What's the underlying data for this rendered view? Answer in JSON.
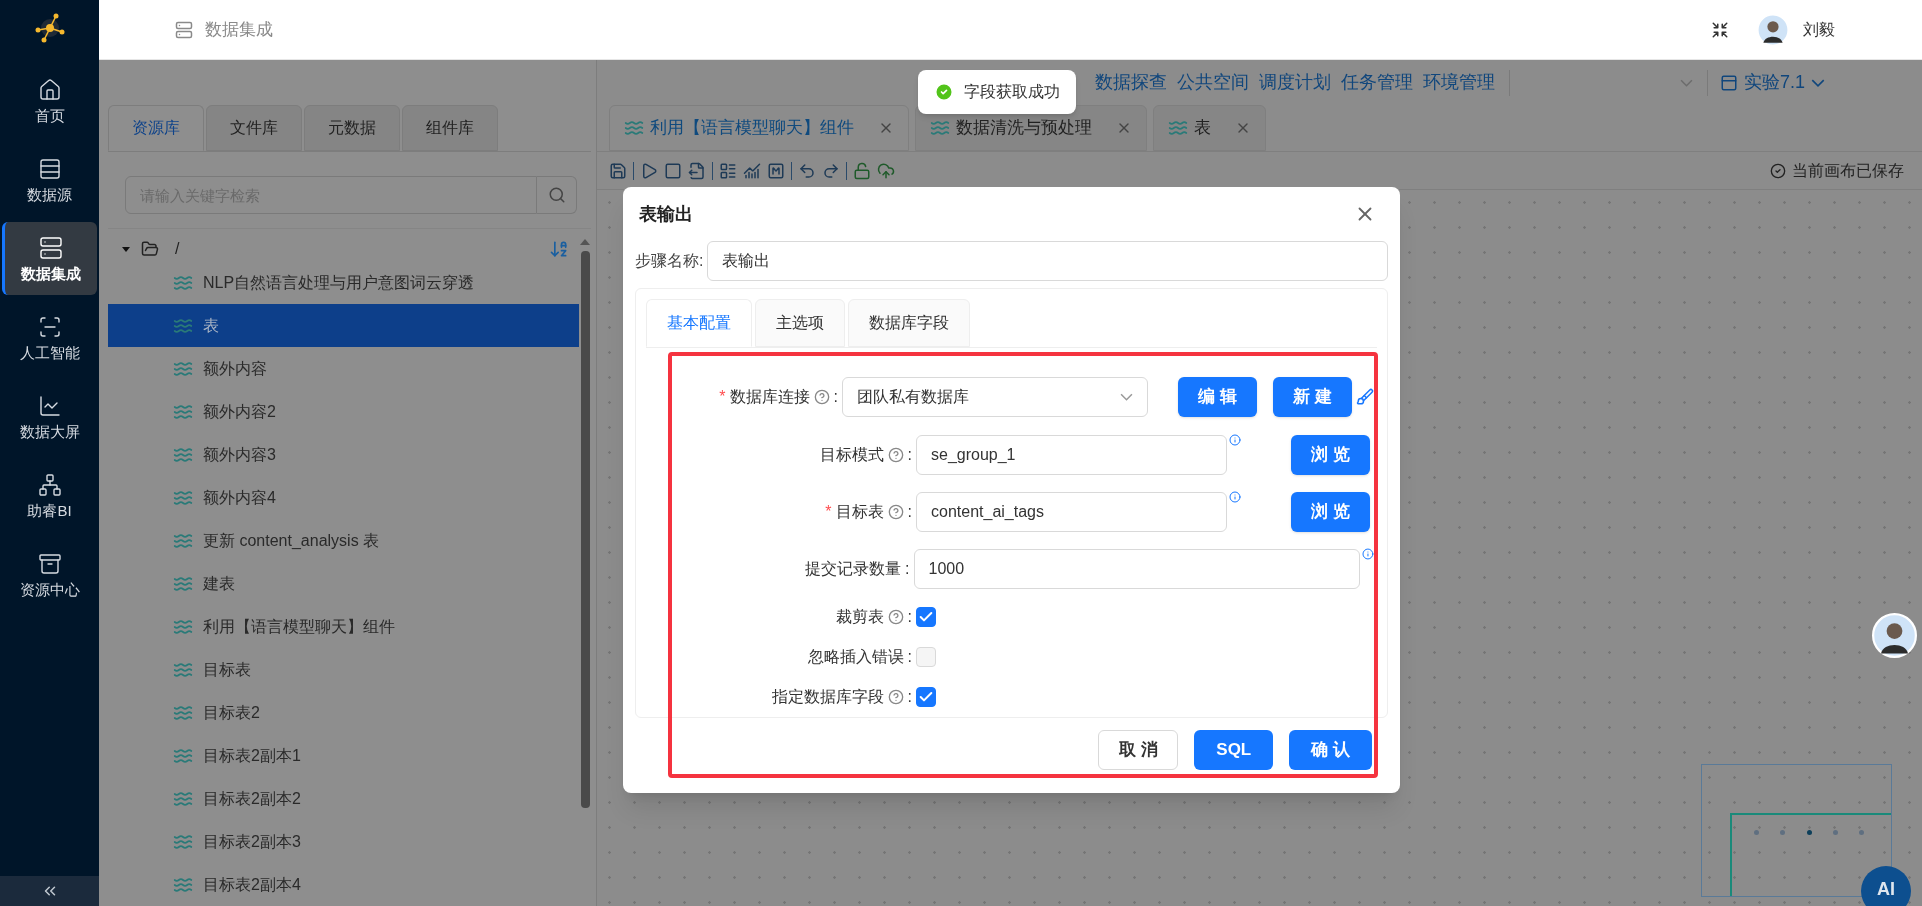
{
  "sidebar": {
    "items": [
      {
        "label": "首页",
        "selected": false
      },
      {
        "label": "数据源",
        "selected": false
      },
      {
        "label": "数据集成",
        "selected": true
      },
      {
        "label": "人工智能",
        "selected": false
      },
      {
        "label": "数据大屏",
        "selected": false
      },
      {
        "label": "助睿BI",
        "selected": false
      },
      {
        "label": "资源中心",
        "selected": false
      }
    ]
  },
  "header": {
    "title": "数据集成",
    "user": "刘毅"
  },
  "top_nav": {
    "links": [
      "数据探查",
      "公共空间",
      "调度计划",
      "任务管理",
      "环境管理"
    ],
    "project": "实验7.1"
  },
  "resource_panel": {
    "tabs": [
      {
        "label": "资源库",
        "selected": true
      },
      {
        "label": "文件库",
        "selected": false
      },
      {
        "label": "元数据",
        "selected": false
      },
      {
        "label": "组件库",
        "selected": false
      }
    ],
    "search": {
      "placeholder": "请输入关键字检索"
    },
    "tree": {
      "label": "/",
      "expanded": true,
      "children": [
        {
          "label": "NLP自然语言处理与用户意图词云穿透",
          "selected": false
        },
        {
          "label": "表",
          "selected": true
        },
        {
          "label": "额外内容",
          "selected": false
        },
        {
          "label": "额外内容2",
          "selected": false
        },
        {
          "label": "额外内容3",
          "selected": false
        },
        {
          "label": "额外内容4",
          "selected": false
        },
        {
          "label": "更新 content_analysis 表",
          "selected": false
        },
        {
          "label": "建表",
          "selected": false
        },
        {
          "label": "利用【语言模型聊天】组件",
          "selected": false
        },
        {
          "label": "目标表",
          "selected": false
        },
        {
          "label": "目标表2",
          "selected": false
        },
        {
          "label": "目标表2副本1",
          "selected": false
        },
        {
          "label": "目标表2副本2",
          "selected": false
        },
        {
          "label": "目标表2副本3",
          "selected": false
        },
        {
          "label": "目标表2副本4",
          "selected": false
        }
      ]
    }
  },
  "editor_tabs": [
    {
      "label": "利用【语言模型聊天】组件",
      "selected": true
    },
    {
      "label": "数据清洗与预处理",
      "selected": false
    },
    {
      "label": "表",
      "selected": false
    }
  ],
  "canvas_status": "当前画布已保存",
  "toast": {
    "message": "字段获取成功"
  },
  "dialog": {
    "title": "表输出",
    "step_name_label": "步骤名称:",
    "step_name": "表输出",
    "tabs": [
      {
        "label": "基本配置",
        "selected": true
      },
      {
        "label": "主选项",
        "selected": false
      },
      {
        "label": "数据库字段",
        "selected": false
      }
    ],
    "rows": [
      {
        "kind": "select",
        "required_mark": "*",
        "label": "数据库连接",
        "help": true,
        "colon": ":",
        "value": "团队私有数据库",
        "buttons": [
          "编 辑",
          "新 建"
        ]
      },
      {
        "kind": "input",
        "label": "目标模式",
        "help": true,
        "colon": ":",
        "value": "se_group_1",
        "button": "浏 览"
      },
      {
        "kind": "input",
        "required_mark": "*",
        "label": "目标表",
        "help": true,
        "colon": ":",
        "value": "content_ai_tags",
        "button": "浏 览"
      },
      {
        "kind": "wide",
        "label": "提交记录数量",
        "help": false,
        "colon": ":",
        "value": "1000"
      },
      {
        "kind": "checkbox",
        "label": "裁剪表",
        "help": true,
        "colon": ":",
        "checked": true
      },
      {
        "kind": "checkbox",
        "label": "忽略插入错误",
        "help": false,
        "colon": ":",
        "checked": false,
        "disabled": true
      },
      {
        "kind": "checkbox",
        "label": "指定数据库字段",
        "help": true,
        "colon": ":",
        "checked": true
      }
    ],
    "buttons": [
      {
        "label": "取 消",
        "kind": "default"
      },
      {
        "label": "SQL",
        "kind": "primary"
      },
      {
        "label": "确 认",
        "kind": "primary"
      }
    ]
  },
  "ai_button": "AI"
}
